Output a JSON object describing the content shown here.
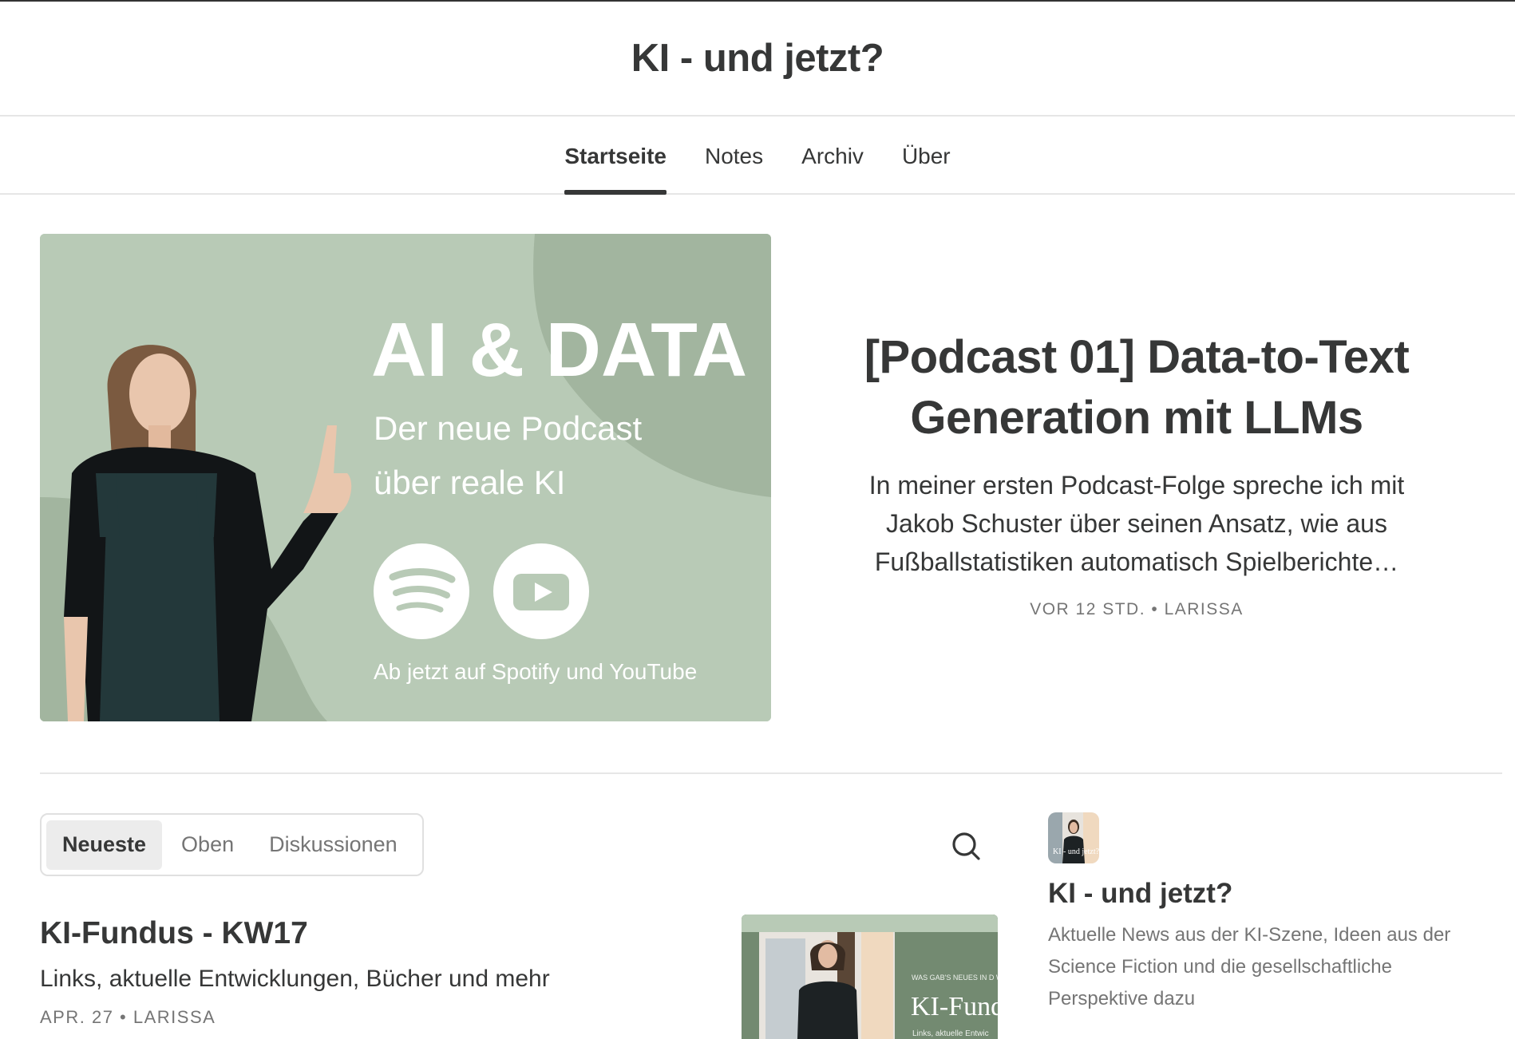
{
  "header": {
    "site_title": "KI - und jetzt?"
  },
  "nav": {
    "items": [
      {
        "label": "Startseite",
        "active": true
      },
      {
        "label": "Notes"
      },
      {
        "label": "Archiv"
      },
      {
        "label": "Über"
      }
    ]
  },
  "hero": {
    "image": {
      "headline": "AI & DATA",
      "line1": "Der neue Podcast",
      "line2": "über reale KI",
      "footer": "Ab jetzt auf Spotify und YouTube",
      "icons": [
        "spotify-icon",
        "youtube-icon"
      ],
      "bg_color": "#b8cab6"
    },
    "title": "[Podcast 01] Data-to-Text Generation mit LLMs",
    "description": "In meiner ersten Podcast-Folge spreche ich mit Jakob Schuster über seinen Ansatz, wie aus Fußballstatistiken automatisch Spielberichte…",
    "meta": "VOR 12 STD. • LARISSA"
  },
  "feed": {
    "tabs": [
      "Neueste",
      "Oben",
      "Diskussionen"
    ],
    "active_tab": "Neueste",
    "search_icon": "search-icon",
    "posts": [
      {
        "title": "KI-Fundus - KW17",
        "subtitle": "Links, aktuelle Entwicklungen, Bücher und mehr",
        "meta": "APR. 27 • LARISSA",
        "thumb_kicker": "WAS GAB'S NEUES IN D WOCHE?",
        "thumb_title": "KI-Fund",
        "thumb_small": "Links, aktuelle Entwic"
      }
    ]
  },
  "sidebar": {
    "avatar_text": "KI - und jetzt?",
    "title": "KI - und jetzt?",
    "description": "Aktuelle News aus der KI-Szene, Ideen aus der Science Fiction und die gesellschaftliche Perspektive dazu"
  }
}
